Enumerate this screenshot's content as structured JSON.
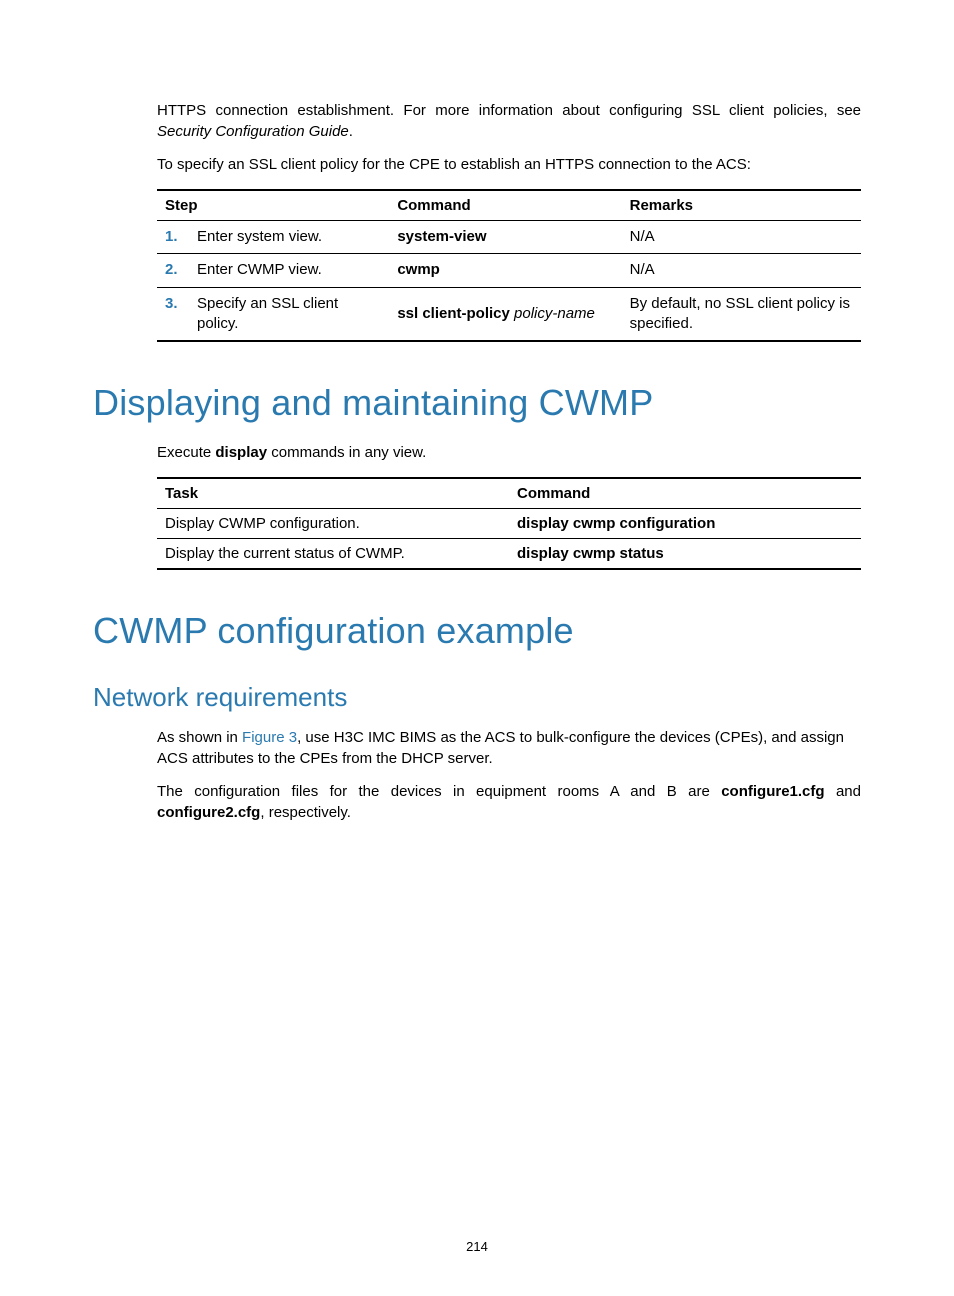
{
  "intro": {
    "line1a": "HTTPS connection establishment. For more information about configuring SSL client policies, see ",
    "line1b_italic": "Security Configuration Guide",
    "line1c": ".",
    "line2": "To specify an SSL client policy for the CPE to establish an HTTPS connection to the ACS:"
  },
  "table1": {
    "headers": {
      "step": "Step",
      "command": "Command",
      "remarks": "Remarks"
    },
    "rows": [
      {
        "num": "1.",
        "step": "Enter system view.",
        "command_bold": "system-view",
        "command_arg": "",
        "remarks": "N/A"
      },
      {
        "num": "2.",
        "step": "Enter CWMP view.",
        "command_bold": "cwmp",
        "command_arg": "",
        "remarks": "N/A"
      },
      {
        "num": "3.",
        "step": "Specify an SSL client policy.",
        "command_bold": "ssl client-policy ",
        "command_arg": "policy-name",
        "remarks": "By default, no SSL client policy is specified."
      }
    ]
  },
  "heading1": "Displaying and maintaining CWMP",
  "display_sentence": {
    "pre": "Execute ",
    "bold": "display",
    "post": " commands in any view."
  },
  "table2": {
    "headers": {
      "task": "Task",
      "command": "Command"
    },
    "rows": [
      {
        "task": "Display CWMP configuration.",
        "command": "display cwmp configuration"
      },
      {
        "task": "Display the current status of CWMP.",
        "command": "display cwmp status"
      }
    ]
  },
  "heading2": "CWMP configuration example",
  "heading3": "Network requirements",
  "para1": {
    "pre": "As shown in ",
    "link": "Figure 3",
    "post": ", use H3C IMC BIMS as the ACS to bulk-configure the devices (CPEs), and assign ACS attributes to the CPEs from the DHCP server."
  },
  "para2": {
    "pre": "The configuration files for the devices in equipment rooms A and B are ",
    "b1": "configure1.cfg",
    "mid": " and ",
    "b2": "configure2.cfg",
    "post": ", respectively."
  },
  "page_number": "214"
}
